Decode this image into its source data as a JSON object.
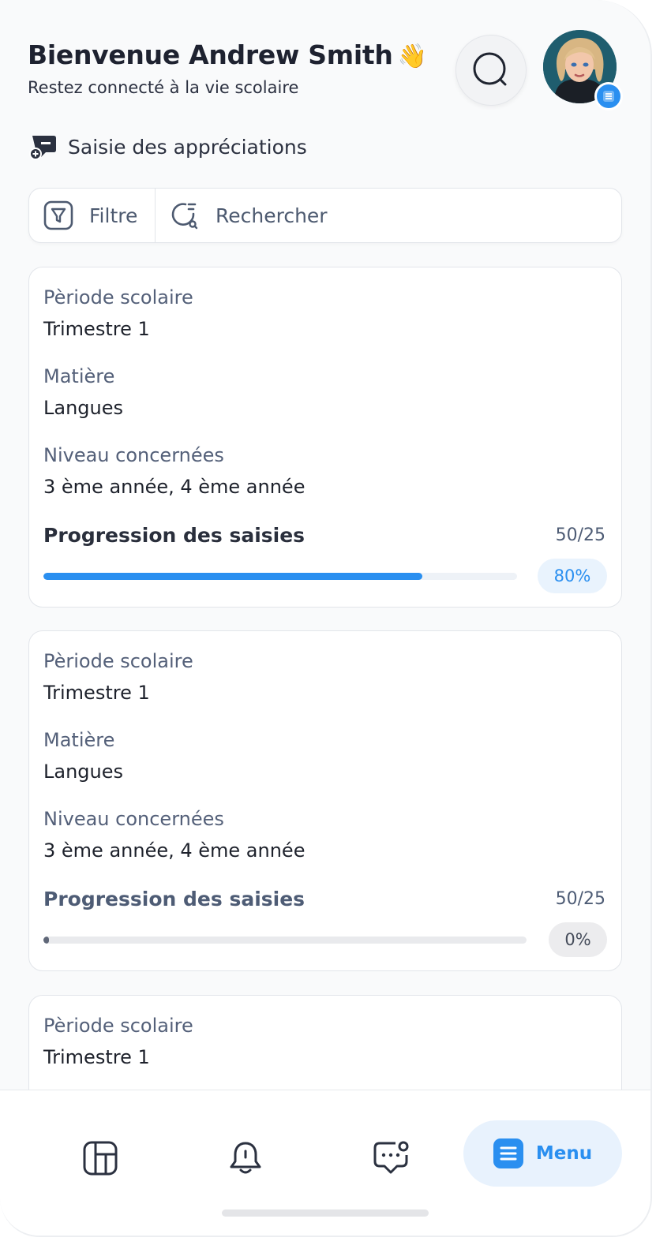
{
  "header": {
    "greeting": "Bienvenue Andrew Smith",
    "wave_emoji": "👋",
    "subtitle": "Restez connecté à la vie scolaire"
  },
  "section": {
    "title": "Saisie des appréciations"
  },
  "filter_bar": {
    "filter_label": "Filtre",
    "search_placeholder": "Rechercher"
  },
  "cards": [
    {
      "period_label": "Pèriode scolaire",
      "period_value": "Trimestre 1",
      "subject_label": "Matière",
      "subject_value": "Langues",
      "level_label": "Niveau concernées",
      "level_value": "3 ème année, 4 ème année",
      "progress_label": "Progression des saisies",
      "progress_count": "50/25",
      "progress_percent_text": "80%",
      "progress_fraction": 0.8
    },
    {
      "period_label": "Pèriode scolaire",
      "period_value": "Trimestre 1",
      "subject_label": "Matière",
      "subject_value": "Langues",
      "level_label": "Niveau concernées",
      "level_value": "3 ème année, 4 ème année",
      "progress_label": "Progression des saisies",
      "progress_count": "50/25",
      "progress_percent_text": "0%",
      "progress_fraction": 0.0
    },
    {
      "period_label": "Pèriode scolaire",
      "period_value": "Trimestre 1"
    }
  ],
  "bottom_nav": {
    "items": [
      {
        "icon": "dashboard-icon"
      },
      {
        "icon": "bell-icon"
      },
      {
        "icon": "chat-icon"
      }
    ],
    "menu_label": "Menu",
    "menu_icon": "menu-icon"
  },
  "colors": {
    "accent": "#2a8ff0",
    "background": "#f9fafb",
    "label": "#546079"
  }
}
